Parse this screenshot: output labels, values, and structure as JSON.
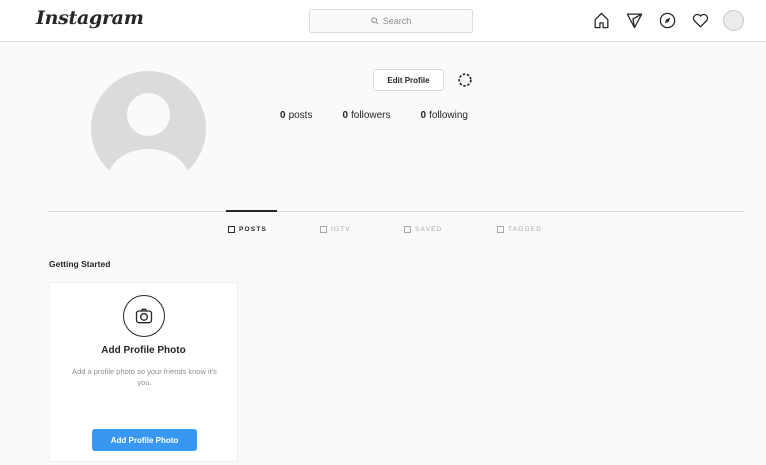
{
  "header": {
    "logo": "Instagram",
    "search_placeholder": "Search",
    "icons": [
      "home-icon",
      "direct-icon",
      "explore-icon",
      "activity-icon",
      "profile-avatar"
    ]
  },
  "profile": {
    "edit_button": "Edit Profile",
    "stats": {
      "posts": {
        "count": "0",
        "label": "posts"
      },
      "followers": {
        "count": "0",
        "label": "followers"
      },
      "following": {
        "count": "0",
        "label": "following"
      }
    }
  },
  "tabs": [
    {
      "label": "POSTS",
      "active": true
    },
    {
      "label": "IGTV",
      "active": false
    },
    {
      "label": "SAVED",
      "active": false
    },
    {
      "label": "TAGGED",
      "active": false
    }
  ],
  "getting_started": {
    "title": "Getting Started",
    "card": {
      "title": "Add Profile Photo",
      "text": "Add a profile photo so your friends know it's you.",
      "button": "Add Profile Photo"
    }
  },
  "colors": {
    "accent": "#3897f0",
    "text": "#262626",
    "muted": "#8e8e8e",
    "border": "#dbdbdb",
    "background": "#fafafa"
  }
}
